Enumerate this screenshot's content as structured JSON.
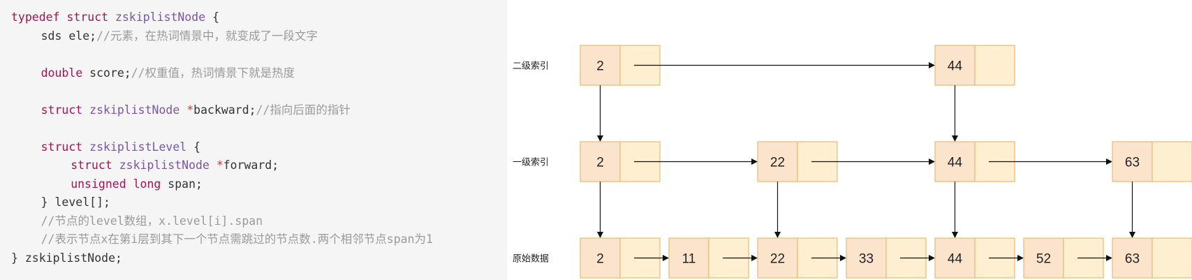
{
  "code": {
    "lines": [
      {
        "indent": 0,
        "tokens": [
          [
            "kw",
            "typedef"
          ],
          [
            "plain",
            " "
          ],
          [
            "kw",
            "struct"
          ],
          [
            "plain",
            " "
          ],
          [
            "type",
            "zskiplistNode"
          ],
          [
            "plain",
            " {"
          ]
        ]
      },
      {
        "indent": 4,
        "tokens": [
          [
            "plain",
            "sds ele;"
          ],
          [
            "comment",
            "//元素，在热词情景中，就变成了一段文字"
          ]
        ]
      },
      {
        "indent": 0,
        "tokens": []
      },
      {
        "indent": 4,
        "tokens": [
          [
            "kw",
            "double"
          ],
          [
            "plain",
            " score;"
          ],
          [
            "comment",
            "//权重值，热词情景下就是热度"
          ]
        ]
      },
      {
        "indent": 0,
        "tokens": []
      },
      {
        "indent": 4,
        "tokens": [
          [
            "kw",
            "struct"
          ],
          [
            "plain",
            " "
          ],
          [
            "type",
            "zskiplistNode"
          ],
          [
            "plain",
            " "
          ],
          [
            "op",
            "*"
          ],
          [
            "plain",
            "backward;"
          ],
          [
            "comment",
            "//指向后面的指针"
          ]
        ]
      },
      {
        "indent": 0,
        "tokens": []
      },
      {
        "indent": 4,
        "tokens": [
          [
            "kw",
            "struct"
          ],
          [
            "plain",
            " "
          ],
          [
            "type",
            "zskiplistLevel"
          ],
          [
            "plain",
            " {"
          ]
        ]
      },
      {
        "indent": 8,
        "tokens": [
          [
            "kw",
            "struct"
          ],
          [
            "plain",
            " "
          ],
          [
            "type",
            "zskiplistNode"
          ],
          [
            "plain",
            " "
          ],
          [
            "op",
            "*"
          ],
          [
            "plain",
            "forward;"
          ]
        ]
      },
      {
        "indent": 8,
        "tokens": [
          [
            "kw",
            "unsigned"
          ],
          [
            "plain",
            " "
          ],
          [
            "kw",
            "long"
          ],
          [
            "plain",
            " span;"
          ]
        ]
      },
      {
        "indent": 4,
        "tokens": [
          [
            "plain",
            "} level[];"
          ]
        ]
      },
      {
        "indent": 4,
        "tokens": [
          [
            "comment",
            "//节点的level数组，x.level[i].span"
          ]
        ]
      },
      {
        "indent": 4,
        "tokens": [
          [
            "comment",
            "//表示节点x在第i层到其下一个节点需跳过的节点数.两个相邻节点span为1"
          ]
        ]
      },
      {
        "indent": 0,
        "tokens": [
          [
            "plain",
            "} zskiplistNode;"
          ]
        ]
      }
    ]
  },
  "colors": {
    "node_key_fill": "#fbe3cc",
    "node_ptr_fill": "#fdefcf",
    "node_stroke": "#e8bf7a",
    "arrow": "#111111"
  },
  "diagram": {
    "levels": [
      {
        "label": "二级索引",
        "nodes": [
          "2",
          "44"
        ]
      },
      {
        "label": "一级索引",
        "nodes": [
          "2",
          "22",
          "44",
          "63"
        ]
      },
      {
        "label": "原始数据",
        "nodes": [
          "2",
          "11",
          "22",
          "33",
          "44",
          "52",
          "63"
        ]
      }
    ]
  }
}
